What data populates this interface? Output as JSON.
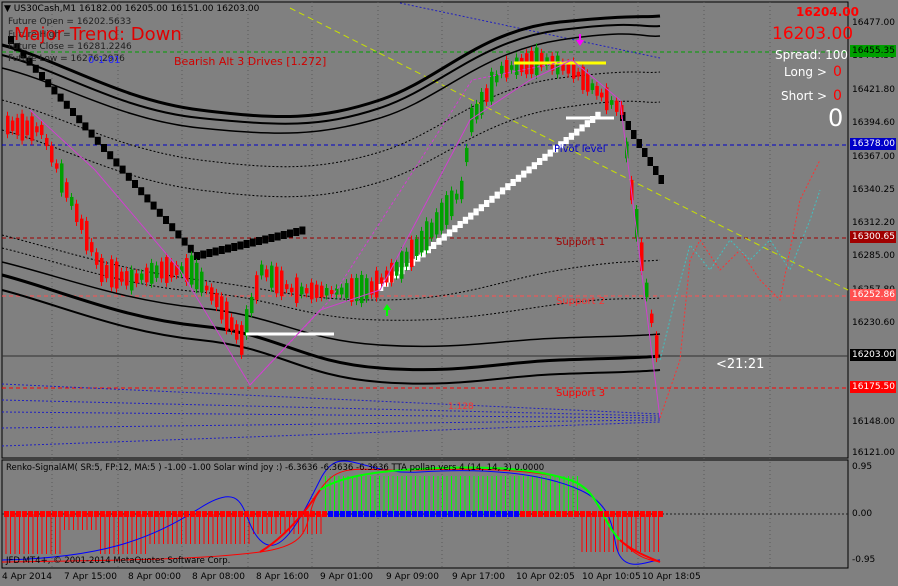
{
  "window": {
    "title": "US30Cash,M1",
    "ohlc": "16182.00 16205.00 16151.00 16203.00"
  },
  "info_lines": [
    "Future Open = 16202.5633",
    "Future High = ",
    "Future Close = 16281.2246",
    "Future Low = 16276.2976"
  ],
  "trend": {
    "text": "Major Trend: Down",
    "color": "#e00000"
  },
  "pattern_label": {
    "text": "Bearish Alt 3 Drives [1.272]",
    "color": "#d00000"
  },
  "pattern_small": "0-1-01",
  "price_panel": {
    "top_price": "16204.00",
    "current_price": "16203.00",
    "spread": "Spread: 100",
    "long_label": "Long >",
    "long_value": "0",
    "short_label": "Short >",
    "short_value": "0",
    "big_zero": "0",
    "timer": "<21:21"
  },
  "levels": {
    "pivot": "Pivot level",
    "support1": "Support 1",
    "support2": "Support 2",
    "support3": "Support 3",
    "fib": "1.128"
  },
  "y_axis": [
    "16477.00",
    "16449.50",
    "16421.80",
    "16394.60",
    "16367.00",
    "16340.25",
    "16312.20",
    "16285.00",
    "16257.80",
    "16230.60",
    "16203.00",
    "16175.50",
    "16148.00",
    "16121.00"
  ],
  "price_tags": [
    {
      "text": "16455.35",
      "bg": "#00a000",
      "color": "#000000"
    },
    {
      "text": "16378.00",
      "bg": "#0000c8",
      "color": "#ffffff"
    },
    {
      "text": "16300.65",
      "bg": "#a00000",
      "color": "#ffffff"
    },
    {
      "text": "16252.86",
      "bg": "#ff5050",
      "color": "#ffffff"
    },
    {
      "text": "16203.00",
      "bg": "#000000",
      "color": "#ffffff"
    },
    {
      "text": "16175.50",
      "bg": "#ff0000",
      "color": "#ffffff"
    }
  ],
  "indicator": {
    "title": "Renko-SignalAM( SR:5, FP:12, MA:5 ) -1.00 -1.00  Solar wind joy :) -6.3636 -6.3636 -6.3636 TTA pollan vers 4 (14, 14, 3) 0.0000",
    "y_axis": [
      "0.95",
      "0.00",
      "-0.95"
    ]
  },
  "copyright": "JFD MT4+, © 2001-2014 MetaQuotes Software Corp.",
  "time_axis": [
    "4 Apr 2014",
    "7 Apr 15:00",
    "8 Apr 00:00",
    "8 Apr 08:00",
    "8 Apr 16:00",
    "9 Apr 01:00",
    "9 Apr 09:00",
    "9 Apr 17:00",
    "10 Apr 02:05",
    "10 Apr 10:05",
    "10 Apr 18:05"
  ]
}
